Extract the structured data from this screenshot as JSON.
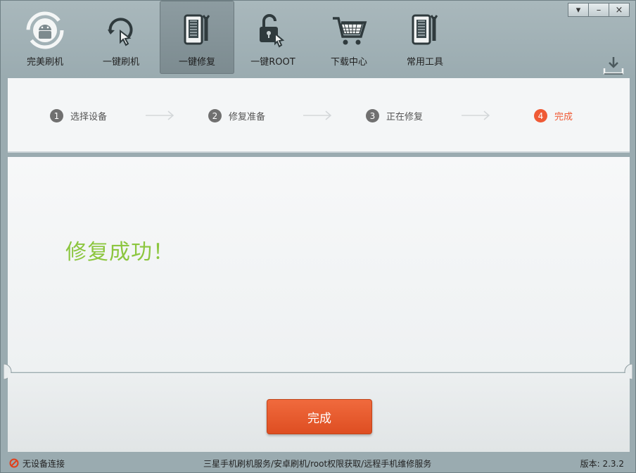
{
  "toolbar": {
    "items": [
      {
        "label": "完美刷机",
        "icon": "android-refresh-icon"
      },
      {
        "label": "一键刷机",
        "icon": "refresh-touch-icon"
      },
      {
        "label": "一键修复",
        "icon": "phone-wrench-icon"
      },
      {
        "label": "一键ROOT",
        "icon": "unlock-icon"
      },
      {
        "label": "下载中心",
        "icon": "cart-icon"
      },
      {
        "label": "常用工具",
        "icon": "phone-tools-icon"
      }
    ],
    "active_index": 2
  },
  "window_controls": {
    "menu": "▾",
    "minimize": "–",
    "close": "×"
  },
  "steps": [
    {
      "num": "1",
      "label": "选择设备"
    },
    {
      "num": "2",
      "label": "修复准备"
    },
    {
      "num": "3",
      "label": "正在修复"
    },
    {
      "num": "4",
      "label": "完成"
    }
  ],
  "content": {
    "message": "修复成功！"
  },
  "actions": {
    "finish": "完成"
  },
  "status": {
    "device": "无设备连接",
    "services": "三星手机刷机服务/安卓刷机/root权限获取/远程手机维修服务",
    "version": "版本: 2.3.2"
  },
  "colors": {
    "accent": "#ef5a35",
    "success": "#8cc63f"
  }
}
